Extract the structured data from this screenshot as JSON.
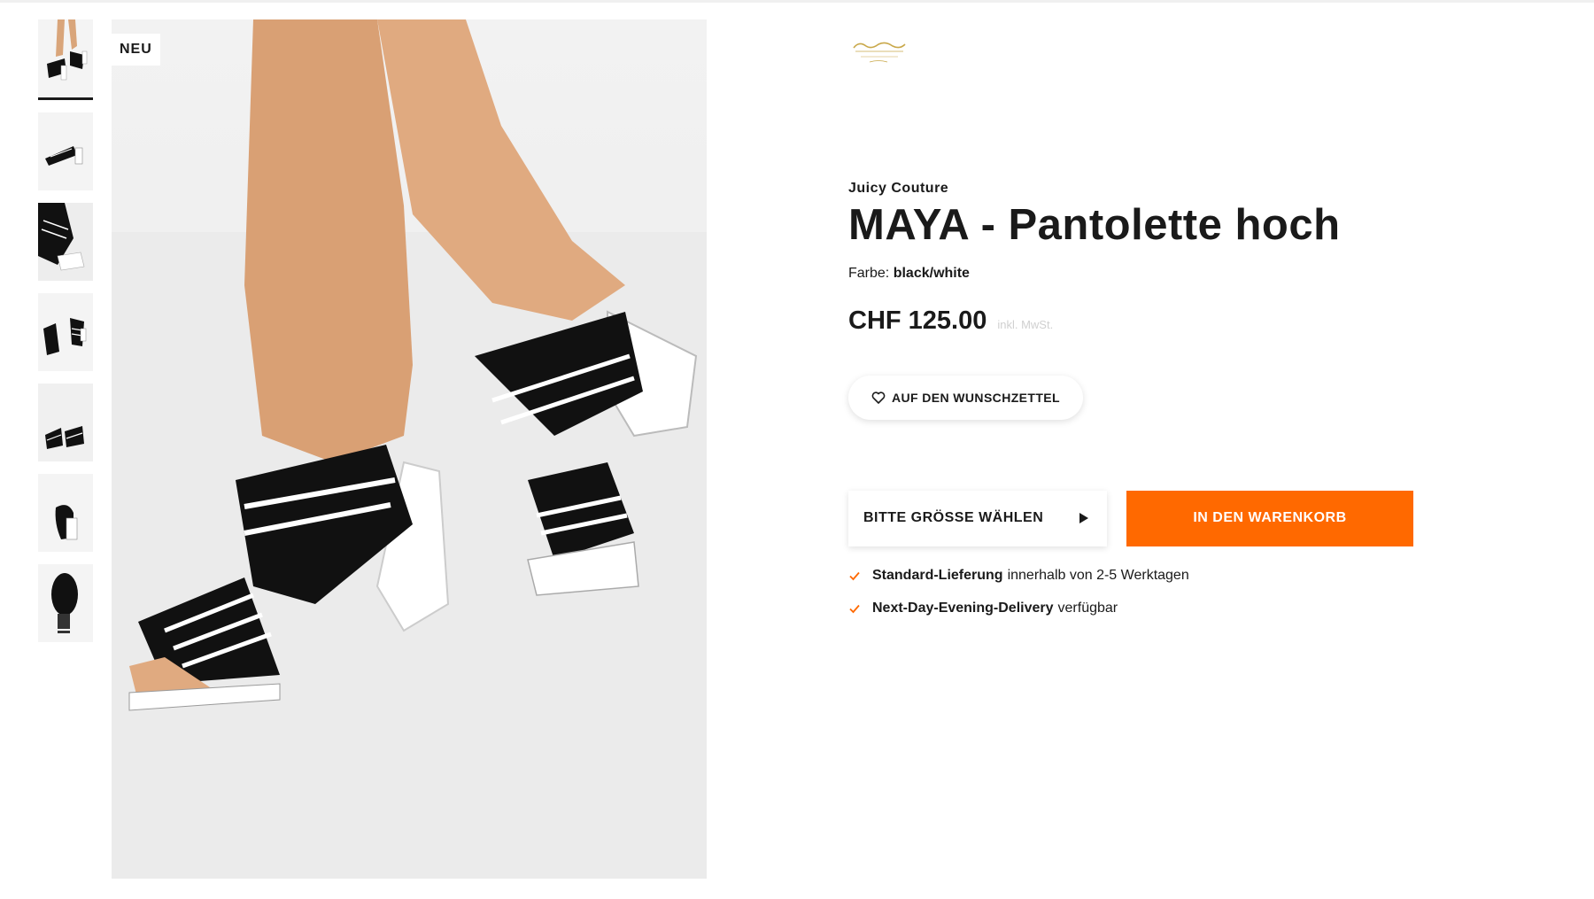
{
  "gallery": {
    "badge": "NEU",
    "thumbnails": [
      "thumb-1",
      "thumb-2",
      "thumb-3",
      "thumb-4",
      "thumb-5",
      "thumb-6",
      "thumb-7"
    ],
    "active_index": 0
  },
  "product": {
    "brand": "Juicy Couture",
    "title": "MAYA - Pantolette hoch",
    "color_label": "Farbe:",
    "color_value": "black/white",
    "price": "CHF 125.00",
    "vat_note": "inkl. MwSt."
  },
  "actions": {
    "wishlist_label": "AUF DEN WUNSCHZETTEL",
    "size_label": "BITTE GRÖSSE WÄHLEN",
    "cart_label": "IN DEN WARENKORB"
  },
  "delivery": [
    {
      "bold": "Standard-Lieferung",
      "text": "innerhalb von 2-5 Werktagen"
    },
    {
      "bold": "Next-Day-Evening-Delivery",
      "text": "verfügbar"
    }
  ],
  "colors": {
    "accent": "#ff6900",
    "text": "#1a1a1a",
    "logo_gold": "#c9a84a"
  }
}
